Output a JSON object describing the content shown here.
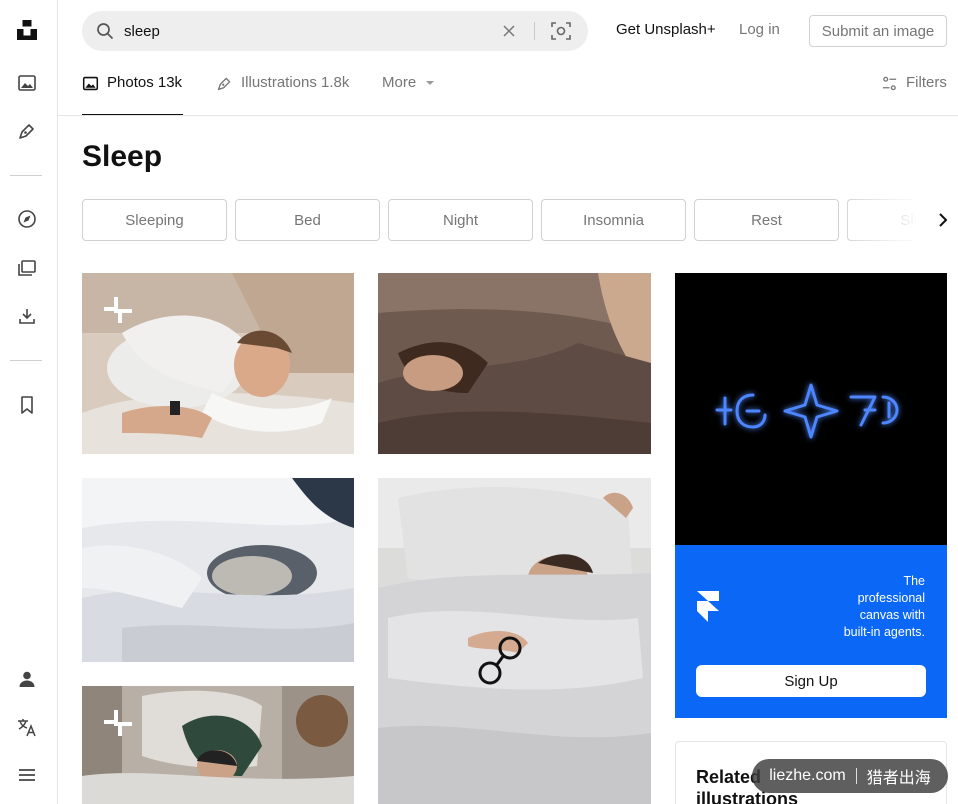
{
  "search": {
    "value": "sleep",
    "icon": "search-icon",
    "clear_icon": "close-icon",
    "visual_search_icon": "visual-search-icon"
  },
  "header": {
    "plus_label": "Get Unsplash+",
    "login_label": "Log in",
    "submit_label": "Submit an image"
  },
  "rail": {
    "items": [
      {
        "name": "unsplash-logo",
        "icon": "unsplash-logo-icon"
      },
      {
        "name": "photos",
        "icon": "image-icon"
      },
      {
        "name": "illustrations",
        "icon": "pen-icon"
      },
      {
        "name": "explore",
        "icon": "compass-icon"
      },
      {
        "name": "collections",
        "icon": "collections-icon"
      },
      {
        "name": "downloads",
        "icon": "download-icon"
      },
      {
        "name": "bookmarks",
        "icon": "bookmark-icon"
      },
      {
        "name": "account",
        "icon": "user-icon"
      },
      {
        "name": "language",
        "icon": "translate-icon"
      },
      {
        "name": "menu",
        "icon": "menu-icon"
      }
    ]
  },
  "tabs": {
    "photos": {
      "label": "Photos",
      "count": "13k"
    },
    "illustrations": {
      "label": "Illustrations",
      "count": "1.8k"
    },
    "more": {
      "label": "More"
    },
    "filters": {
      "label": "Filters"
    }
  },
  "page": {
    "title": "Sleep"
  },
  "related_searches": [
    "Sleeping",
    "Bed",
    "Night",
    "Insomnia",
    "Rest",
    "Sleep"
  ],
  "ad": {
    "copy_line1": "The",
    "copy_line2": "professional",
    "copy_line3": "canvas with",
    "copy_line4": "built-in agents.",
    "button_label": "Sign Up",
    "logo_icon": "framer-logo-icon"
  },
  "related_card": {
    "title": "Related illustrations"
  },
  "watermark": {
    "left": "liezhe.com",
    "right": "猎者出海"
  },
  "colors": {
    "accent": "#111111",
    "muted": "#767676",
    "border": "#d1d1d1",
    "ad_blue": "#0b67f5",
    "neon_blue": "#2f6bff"
  }
}
